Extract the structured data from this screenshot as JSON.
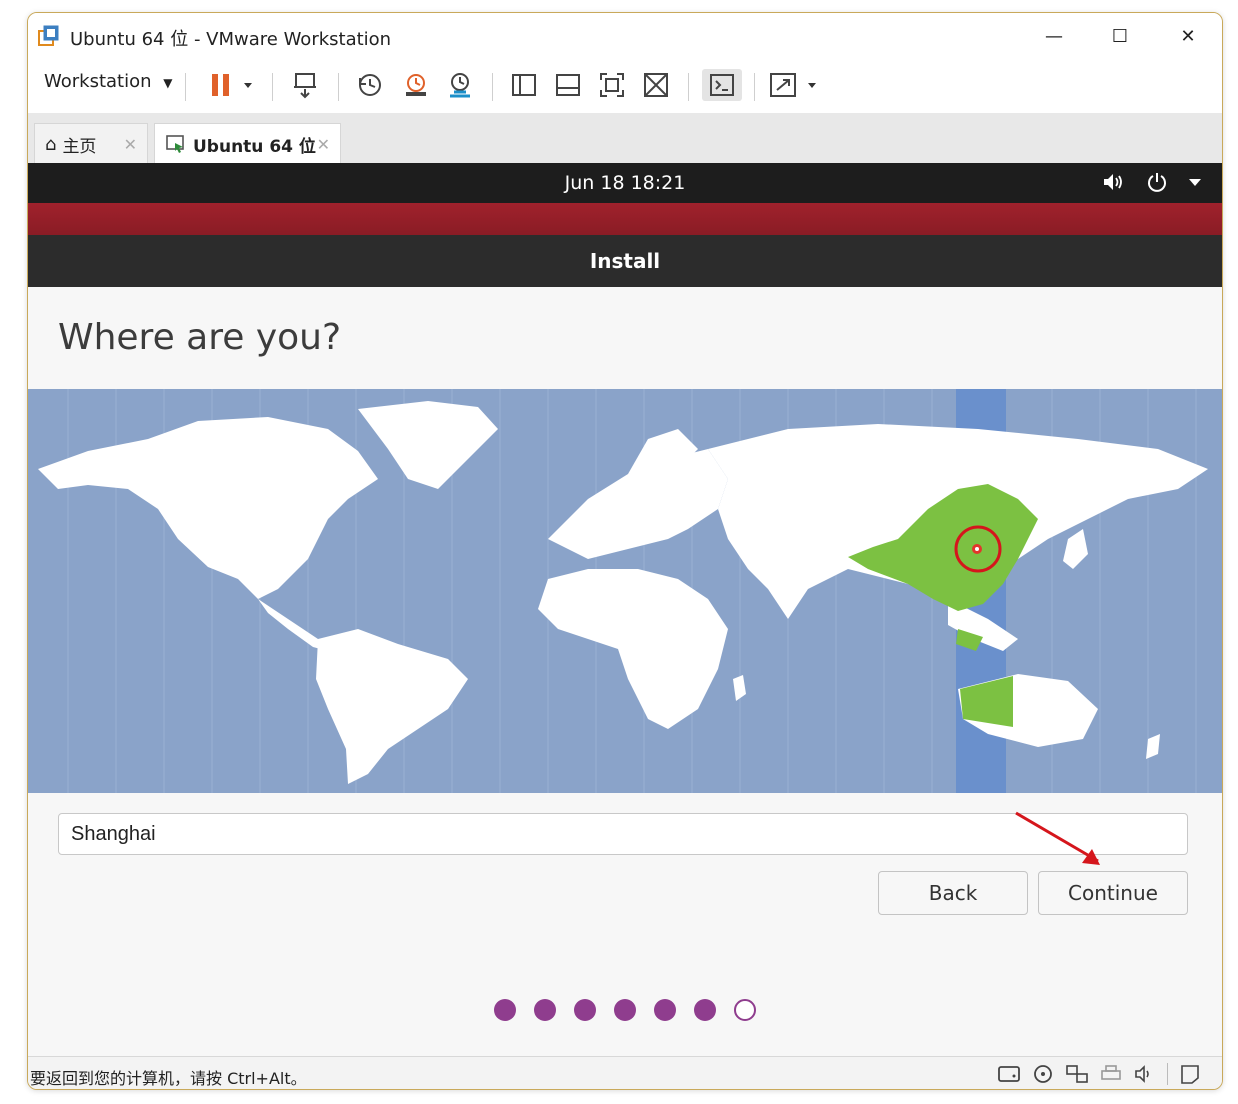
{
  "window": {
    "title": "Ubuntu 64 位 - VMware Workstation",
    "controls": {
      "minimize": "—",
      "maximize": "☐",
      "close": "✕"
    }
  },
  "toolbar": {
    "workstation_label": "Workstation",
    "icons": [
      "pause-icon",
      "send-keys-icon",
      "snapshot-icon",
      "snapshot-revert-icon",
      "snapshot-manager-icon",
      "sidebar-view-icon",
      "thumbnail-view-icon",
      "fullscreen-icon",
      "unity-icon",
      "console-icon",
      "stretch-icon"
    ]
  },
  "tabs": [
    {
      "label": "主页",
      "close": "✕"
    },
    {
      "label": "Ubuntu 64 位",
      "close": "✕"
    }
  ],
  "vm": {
    "topbar": {
      "datetime": "Jun 18  18:21"
    },
    "installer": {
      "header": "Install",
      "heading": "Where are you?",
      "timezone_input": {
        "value": "Shanghai"
      },
      "back_label": "Back",
      "continue_label": "Continue",
      "progress": {
        "total_steps": 7,
        "completed_steps": 6
      }
    }
  },
  "statusbar": {
    "hint": "要返回到您的计算机，请按 Ctrl+Alt。"
  },
  "colors": {
    "accent": "#8f3d8e",
    "map_ocean": "#8aa3c9",
    "timezone_band": "#6a90cc",
    "selected_country": "#7cc142",
    "red_band": "#a0212c"
  }
}
